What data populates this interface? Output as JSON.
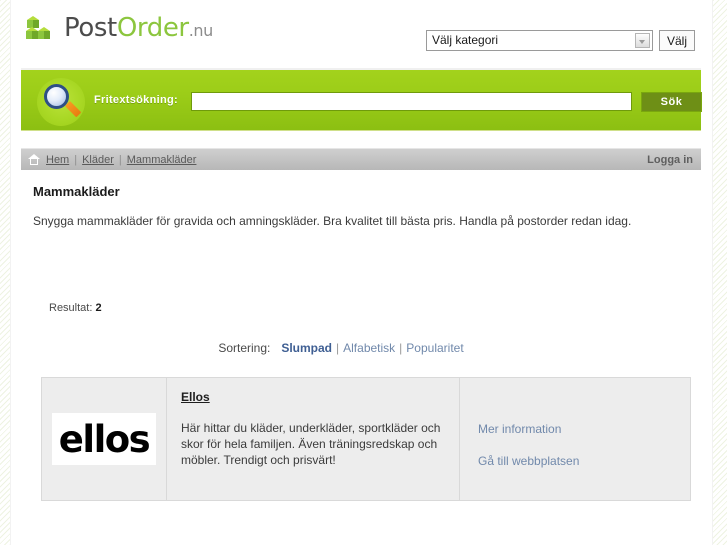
{
  "header": {
    "logo": {
      "icon": "cubes-icon",
      "part1": "Post",
      "part2": "Order",
      "part3": ".nu"
    },
    "category": {
      "selected": "Välj kategori",
      "submit_label": "Välj"
    }
  },
  "search": {
    "icon": "magnifier-icon",
    "label": "Fritextsökning:",
    "value": "",
    "placeholder": "",
    "button_label": "Sök"
  },
  "breadcrumb": {
    "home_icon": "home-icon",
    "items": [
      {
        "label": "Hem"
      },
      {
        "label": "Kläder"
      },
      {
        "label": "Mammakläder"
      }
    ],
    "separator": "|",
    "login_label": "Logga in"
  },
  "main": {
    "title": "Mammakläder",
    "description": "Snygga mammakläder för gravida och amningskläder. Bra kvalitet till bästa pris. Handla på postorder redan idag.",
    "result_label": "Resultat:",
    "result_count": "2",
    "sorting": {
      "label": "Sortering:",
      "separator": "|",
      "options": [
        {
          "label": "Slumpad",
          "active": true
        },
        {
          "label": "Alfabetisk",
          "active": false
        },
        {
          "label": "Popularitet",
          "active": false
        }
      ]
    },
    "results": [
      {
        "logo_text": "ellos",
        "title": "Ellos",
        "description": "Här hittar du kläder, underkläder, sportkläder och skor för hela familjen. Även träningsredskap och möbler. Trendigt och prisvärt!",
        "link_info": "Mer information",
        "link_site": "Gå till webbplatsen"
      }
    ]
  },
  "colors": {
    "brand_green": "#8cc63e",
    "bar_green": "#9ccd18",
    "button_green": "#6e8f16",
    "link_blue": "#7189ab",
    "breadcrumb_gray": "#c3c3c3"
  }
}
